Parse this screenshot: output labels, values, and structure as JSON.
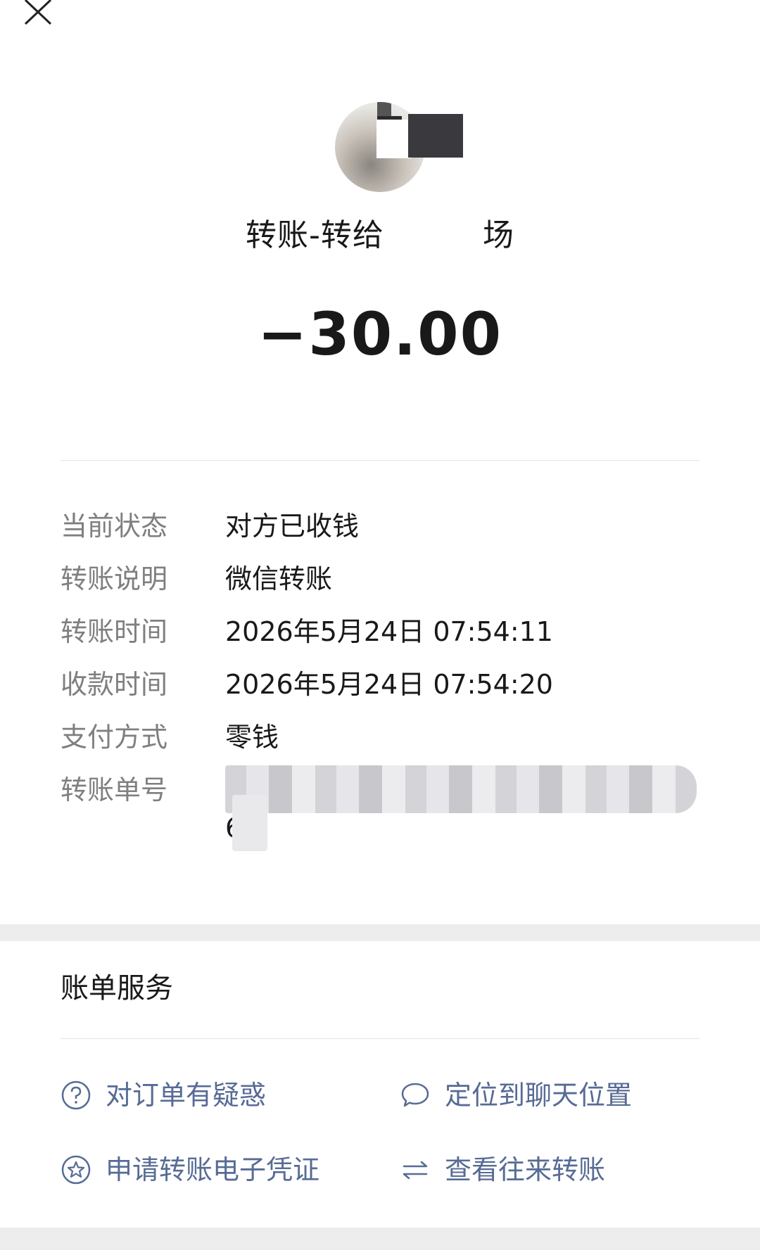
{
  "header": {
    "close_icon": "close-icon"
  },
  "payee": {
    "title_prefix": "转账-转给",
    "title_suffix": "场"
  },
  "amount": "−30.00",
  "details": [
    {
      "label": "当前状态",
      "value": "对方已收钱"
    },
    {
      "label": "转账说明",
      "value": "微信转账"
    },
    {
      "label": "转账时间",
      "value": "2026年5月24日 07:54:11"
    },
    {
      "label": "收款时间",
      "value": "2026年5月24日 07:54:20"
    },
    {
      "label": "支付方式",
      "value": "零钱"
    },
    {
      "label": "转账单号",
      "value": "69"
    }
  ],
  "services": {
    "title": "账单服务",
    "items": [
      {
        "label": "对订单有疑惑",
        "icon": "question-circle-icon"
      },
      {
        "label": "定位到聊天位置",
        "icon": "chat-bubble-icon"
      },
      {
        "label": "申请转账电子凭证",
        "icon": "star-circle-icon"
      },
      {
        "label": "查看往来转账",
        "icon": "transfer-arrows-icon"
      }
    ]
  },
  "colors": {
    "link": "#576b95",
    "label": "#7f7f7f",
    "text": "#191919",
    "band": "#ededed"
  }
}
